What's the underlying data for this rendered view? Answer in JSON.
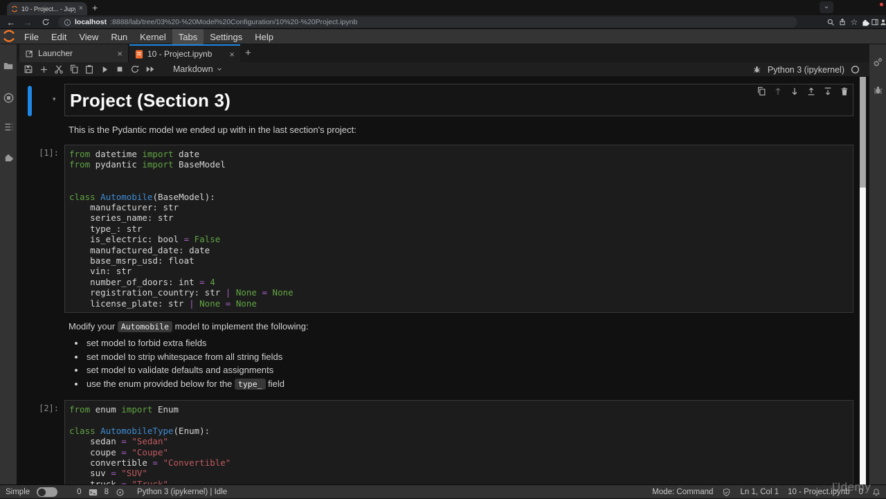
{
  "browser": {
    "tab_title": "10 - Project... - JupyterLab",
    "close_tab": "×",
    "new_tab": "+",
    "back": "←",
    "forward": "→",
    "url_host": "localhost",
    "url_rest": ":8888/lab/tree/03%20-%20Model%20Configuration/10%20-%20Project.ipynb",
    "overflow_chevron": "⌄",
    "menu_dots": "⋮",
    "star": "☆"
  },
  "menu": {
    "items": [
      {
        "label": "File"
      },
      {
        "label": "Edit"
      },
      {
        "label": "View"
      },
      {
        "label": "Run"
      },
      {
        "label": "Kernel"
      },
      {
        "label": "Tabs",
        "active": true
      },
      {
        "label": "Settings"
      },
      {
        "label": "Help"
      }
    ]
  },
  "lab_tabs": {
    "launcher": "Launcher",
    "notebook": "10 - Project.ipynb",
    "close": "×",
    "add": "+"
  },
  "toolbar": {
    "cell_type": "Markdown",
    "kernel_name": "Python 3 (ipykernel)"
  },
  "cells": {
    "md1": {
      "heading": "Project (Section 3)",
      "chevron": "▾"
    },
    "md2": {
      "text": "This is the Pydantic model we ended up with in the last section's project:"
    },
    "code1": {
      "prompt": "[1]:",
      "lines": [
        [
          [
            "k",
            "from"
          ],
          [
            "",
            " datetime "
          ],
          [
            "k",
            "import"
          ],
          [
            "",
            " date"
          ]
        ],
        [
          [
            "k",
            "from"
          ],
          [
            "",
            " pydantic "
          ],
          [
            "k",
            "import"
          ],
          [
            "",
            " BaseModel"
          ]
        ],
        [],
        [],
        [
          [
            "k",
            "class"
          ],
          [
            "",
            " "
          ],
          [
            "c",
            "Automobile"
          ],
          [
            "",
            "(BaseModel):"
          ]
        ],
        [
          [
            "",
            "    manufacturer: str"
          ]
        ],
        [
          [
            "",
            "    series_name: str"
          ]
        ],
        [
          [
            "",
            "    type_: str"
          ]
        ],
        [
          [
            "",
            "    is_electric: bool "
          ],
          [
            "o",
            "="
          ],
          [
            "",
            " "
          ],
          [
            "a",
            "False"
          ]
        ],
        [
          [
            "",
            "    manufactured_date: date"
          ]
        ],
        [
          [
            "",
            "    base_msrp_usd: float"
          ]
        ],
        [
          [
            "",
            "    vin: str"
          ]
        ],
        [
          [
            "",
            "    number_of_doors: int "
          ],
          [
            "o",
            "="
          ],
          [
            "",
            " "
          ],
          [
            "a",
            "4"
          ]
        ],
        [
          [
            "",
            "    registration_country: str "
          ],
          [
            "o",
            "|"
          ],
          [
            "",
            " "
          ],
          [
            "a",
            "None"
          ],
          [
            "",
            " "
          ],
          [
            "o",
            "="
          ],
          [
            "",
            " "
          ],
          [
            "a",
            "None"
          ]
        ],
        [
          [
            "",
            "    license_plate: str "
          ],
          [
            "o",
            "|"
          ],
          [
            "",
            " "
          ],
          [
            "a",
            "None"
          ],
          [
            "",
            " "
          ],
          [
            "o",
            "="
          ],
          [
            "",
            " "
          ],
          [
            "a",
            "None"
          ]
        ]
      ]
    },
    "md3": {
      "intro": [
        [
          "",
          "Modify your "
        ],
        [
          "ic",
          "Automobile"
        ],
        [
          "",
          " model to implement the following:"
        ]
      ],
      "bullets": [
        [
          [
            "",
            "set model to forbid extra fields"
          ]
        ],
        [
          [
            "",
            "set model to strip whitespace from all string fields"
          ]
        ],
        [
          [
            "",
            "set model to validate defaults and assignments"
          ]
        ],
        [
          [
            "",
            "use the enum provided below for the "
          ],
          [
            "ic",
            "type_"
          ],
          [
            "",
            " field"
          ]
        ]
      ]
    },
    "code2": {
      "prompt": "[2]:",
      "lines": [
        [
          [
            "k",
            "from"
          ],
          [
            "",
            " enum "
          ],
          [
            "k",
            "import"
          ],
          [
            "",
            " Enum"
          ]
        ],
        [],
        [
          [
            "k",
            "class"
          ],
          [
            "",
            " "
          ],
          [
            "c",
            "AutomobileType"
          ],
          [
            "",
            "(Enum):"
          ]
        ],
        [
          [
            "",
            "    sedan "
          ],
          [
            "o",
            "="
          ],
          [
            "",
            " "
          ],
          [
            "s",
            "\"Sedan\""
          ]
        ],
        [
          [
            "",
            "    coupe "
          ],
          [
            "o",
            "="
          ],
          [
            "",
            " "
          ],
          [
            "s",
            "\"Coupe\""
          ]
        ],
        [
          [
            "",
            "    convertible "
          ],
          [
            "o",
            "="
          ],
          [
            "",
            " "
          ],
          [
            "s",
            "\"Convertible\""
          ]
        ],
        [
          [
            "",
            "    suv "
          ],
          [
            "o",
            "="
          ],
          [
            "",
            " "
          ],
          [
            "s",
            "\"SUV\""
          ]
        ],
        [
          [
            "",
            "    truck "
          ],
          [
            "o",
            "="
          ],
          [
            "",
            " "
          ],
          [
            "s",
            "\"Truck\""
          ]
        ]
      ]
    }
  },
  "status": {
    "simple_label": "Simple",
    "terminal_count": "0",
    "kernel_count": "8",
    "kernel_status": "Python 3 (ipykernel) | Idle",
    "mode": "Mode: Command",
    "cursor": "Ln 1, Col 1",
    "file_name": "10 - Project.ipynb",
    "notification_count": "0"
  },
  "watermark": {
    "caret": "ˆ",
    "text": "Udemy"
  },
  "colors": {
    "accent_blue": "#1e88e5",
    "jupyter_orange": "#f37726",
    "syntax_keyword": "#61a543",
    "syntax_operator": "#a75fc5",
    "syntax_string": "#c05a60",
    "syntax_class": "#3f8cd4",
    "scrollbar_track": "#f7f7f7",
    "scrollbar_thumb": "#a8a8a8"
  }
}
